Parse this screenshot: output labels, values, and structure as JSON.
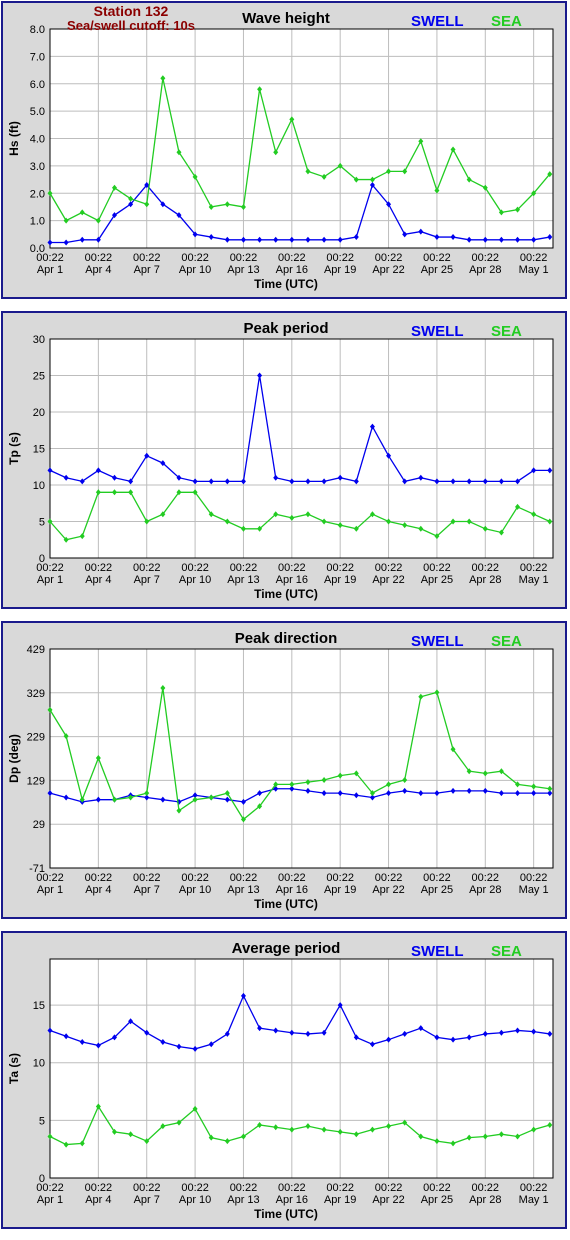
{
  "station": {
    "name": "Station 132",
    "cutoff": "Sea/swell cutoff: 10s"
  },
  "legend": {
    "swell": "SWELL",
    "sea": "SEA",
    "swell_color": "#0000ee",
    "sea_color": "#22cc22"
  },
  "x_ticks": {
    "time_labels": [
      "00:22",
      "00:22",
      "00:22",
      "00:22",
      "00:22",
      "00:22",
      "00:22",
      "00:22",
      "00:22",
      "00:22",
      "00:22"
    ],
    "date_labels": [
      "Apr 1",
      "Apr 4",
      "Apr 7",
      "Apr 10",
      "Apr 13",
      "Apr 16",
      "Apr 19",
      "Apr 22",
      "Apr 25",
      "Apr 28",
      "May 1"
    ],
    "xlabel": "Time (UTC)"
  },
  "chart_data": [
    {
      "type": "line",
      "title": "Wave height",
      "ylabel": "Hs (ft)",
      "ylim": [
        0,
        8
      ],
      "yticks": [
        "0.0",
        "1.0",
        "2.0",
        "3.0",
        "4.0",
        "5.0",
        "6.0",
        "7.0",
        "8.0"
      ],
      "x_days": [
        0,
        1,
        2,
        3,
        4,
        5,
        6,
        7,
        8,
        9,
        10,
        11,
        12,
        13,
        14,
        15,
        16,
        17,
        18,
        19,
        20,
        21,
        22,
        23,
        24,
        25,
        26,
        27,
        28,
        29,
        30,
        31
      ],
      "series": [
        {
          "name": "SWELL",
          "values": [
            0.2,
            0.2,
            0.3,
            0.3,
            1.2,
            1.6,
            2.3,
            1.6,
            1.2,
            0.5,
            0.4,
            0.3,
            0.3,
            0.3,
            0.3,
            0.3,
            0.3,
            0.3,
            0.3,
            0.4,
            2.3,
            1.6,
            0.5,
            0.6,
            0.4,
            0.4,
            0.3,
            0.3,
            0.3,
            0.3,
            0.3,
            0.4
          ]
        },
        {
          "name": "SEA",
          "values": [
            2.0,
            1.0,
            1.3,
            1.0,
            2.2,
            1.8,
            1.6,
            6.2,
            3.5,
            2.6,
            1.5,
            1.6,
            1.5,
            5.8,
            3.5,
            4.7,
            2.8,
            2.6,
            3.0,
            2.5,
            2.5,
            2.8,
            2.8,
            3.9,
            2.1,
            3.6,
            2.5,
            2.2,
            1.3,
            1.4,
            2.0,
            2.7
          ]
        }
      ]
    },
    {
      "type": "line",
      "title": "Peak period",
      "ylabel": "Tp (s)",
      "ylim": [
        0,
        30
      ],
      "yticks": [
        "0",
        "5",
        "10",
        "15",
        "20",
        "25",
        "30"
      ],
      "x_days": [
        0,
        1,
        2,
        3,
        4,
        5,
        6,
        7,
        8,
        9,
        10,
        11,
        12,
        13,
        14,
        15,
        16,
        17,
        18,
        19,
        20,
        21,
        22,
        23,
        24,
        25,
        26,
        27,
        28,
        29,
        30,
        31
      ],
      "series": [
        {
          "name": "SWELL",
          "values": [
            12,
            11,
            10.5,
            12,
            11,
            10.5,
            14,
            13,
            11,
            10.5,
            10.5,
            10.5,
            10.5,
            25,
            11,
            10.5,
            10.5,
            10.5,
            11,
            10.5,
            18,
            14,
            10.5,
            11,
            10.5,
            10.5,
            10.5,
            10.5,
            10.5,
            10.5,
            12,
            12
          ]
        },
        {
          "name": "SEA",
          "values": [
            5,
            2.5,
            3,
            9,
            9,
            9,
            5,
            6,
            9,
            9,
            6,
            5,
            4,
            4,
            6,
            5.5,
            6,
            5,
            4.5,
            4,
            6,
            5,
            4.5,
            4,
            3,
            5,
            5,
            4,
            3.5,
            7,
            6,
            5
          ]
        }
      ]
    },
    {
      "type": "line",
      "title": "Peak direction",
      "ylabel": "Dp (deg)",
      "ylim": [
        -71,
        429
      ],
      "yticks": [
        "-71",
        "29",
        "129",
        "229",
        "329",
        "429"
      ],
      "x_days": [
        0,
        1,
        2,
        3,
        4,
        5,
        6,
        7,
        8,
        9,
        10,
        11,
        12,
        13,
        14,
        15,
        16,
        17,
        18,
        19,
        20,
        21,
        22,
        23,
        24,
        25,
        26,
        27,
        28,
        29,
        30,
        31
      ],
      "series": [
        {
          "name": "SWELL",
          "values": [
            100,
            90,
            80,
            85,
            85,
            95,
            90,
            85,
            80,
            95,
            90,
            85,
            80,
            100,
            110,
            110,
            105,
            100,
            100,
            95,
            90,
            100,
            105,
            100,
            100,
            105,
            105,
            105,
            100,
            100,
            100,
            100
          ]
        },
        {
          "name": "SEA",
          "values": [
            290,
            230,
            85,
            180,
            85,
            90,
            100,
            340,
            60,
            85,
            90,
            100,
            40,
            70,
            120,
            120,
            125,
            130,
            140,
            145,
            100,
            120,
            130,
            320,
            330,
            200,
            150,
            145,
            150,
            120,
            115,
            110
          ]
        }
      ]
    },
    {
      "type": "line",
      "title": "Average period",
      "ylabel": "Ta (s)",
      "ylim": [
        0,
        19
      ],
      "yticks": [
        "0",
        "5",
        "10",
        "15"
      ],
      "x_days": [
        0,
        1,
        2,
        3,
        4,
        5,
        6,
        7,
        8,
        9,
        10,
        11,
        12,
        13,
        14,
        15,
        16,
        17,
        18,
        19,
        20,
        21,
        22,
        23,
        24,
        25,
        26,
        27,
        28,
        29,
        30,
        31
      ],
      "series": [
        {
          "name": "SWELL",
          "values": [
            12.8,
            12.3,
            11.8,
            11.5,
            12.2,
            13.6,
            12.6,
            11.8,
            11.4,
            11.2,
            11.6,
            12.5,
            15.8,
            13.0,
            12.8,
            12.6,
            12.5,
            12.6,
            15.0,
            12.2,
            11.6,
            12.0,
            12.5,
            13.0,
            12.2,
            12.0,
            12.2,
            12.5,
            12.6,
            12.8,
            12.7,
            12.5
          ]
        },
        {
          "name": "SEA",
          "values": [
            3.6,
            2.9,
            3.0,
            6.2,
            4.0,
            3.8,
            3.2,
            4.5,
            4.8,
            6.0,
            3.5,
            3.2,
            3.6,
            4.6,
            4.4,
            4.2,
            4.5,
            4.2,
            4.0,
            3.8,
            4.2,
            4.5,
            4.8,
            3.6,
            3.2,
            3.0,
            3.5,
            3.6,
            3.8,
            3.6,
            4.2,
            4.6
          ]
        }
      ]
    }
  ]
}
